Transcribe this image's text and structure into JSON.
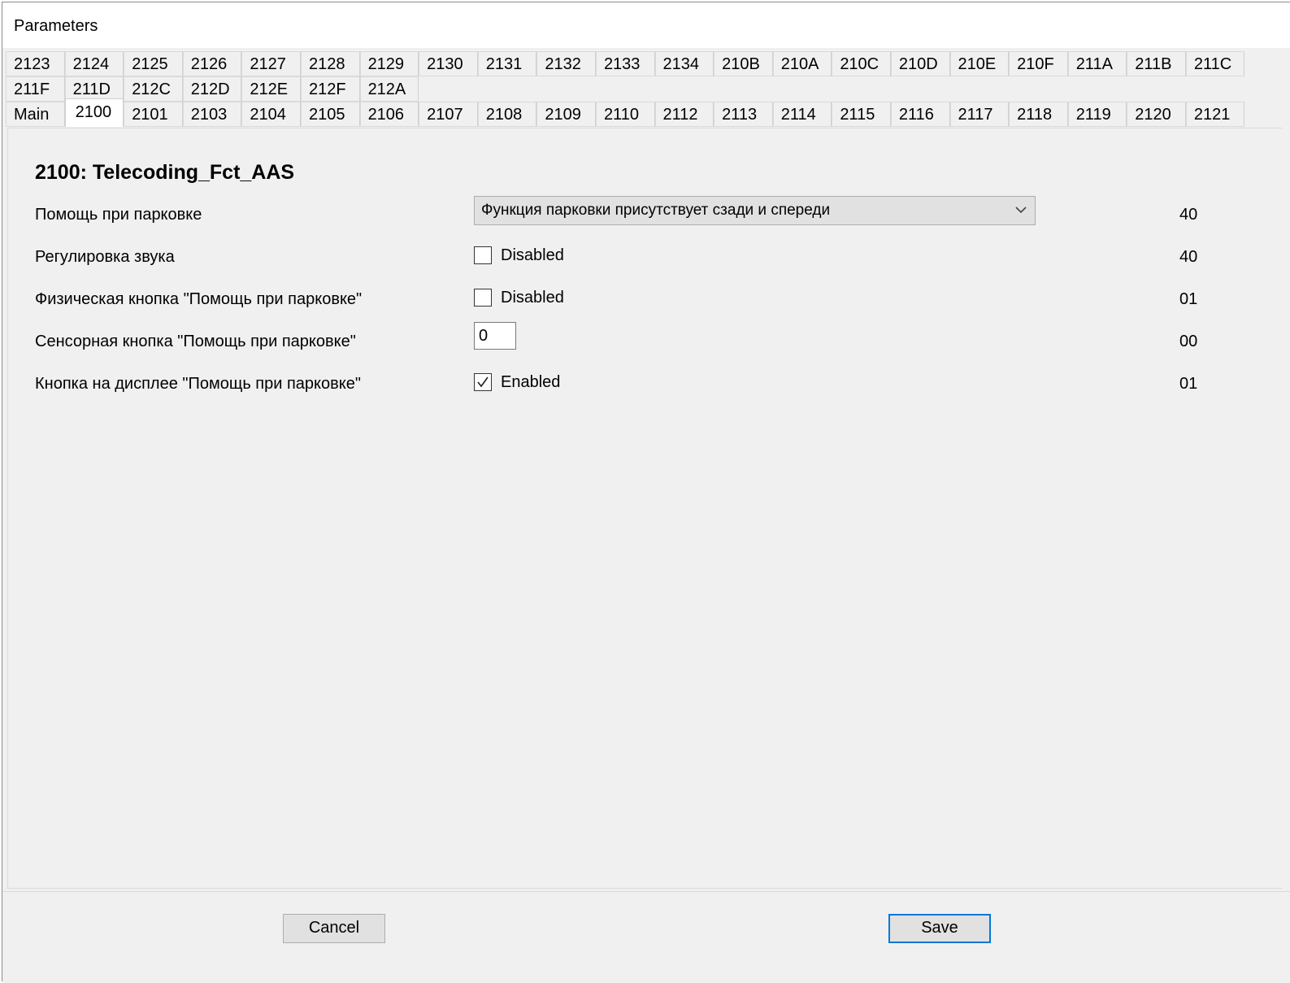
{
  "window": {
    "title": "Parameters"
  },
  "tabs": {
    "row1": [
      "2123",
      "2124",
      "2125",
      "2126",
      "2127",
      "2128",
      "2129",
      "2130",
      "2131",
      "2132",
      "2133",
      "2134",
      "210B",
      "210A",
      "210C",
      "210D",
      "210E",
      "210F",
      "211A",
      "211B",
      "211C"
    ],
    "row2": [
      "211F",
      "211D",
      "212C",
      "212D",
      "212E",
      "212F",
      "212A"
    ],
    "row3": [
      "Main",
      "2100",
      "2101",
      "2103",
      "2104",
      "2105",
      "2106",
      "2107",
      "2108",
      "2109",
      "2110",
      "2112",
      "2113",
      "2114",
      "2115",
      "2116",
      "2117",
      "2118",
      "2119",
      "2120",
      "2121"
    ],
    "active": "2100"
  },
  "panel": {
    "title": "2100: Telecoding_Fct_AAS",
    "params": [
      {
        "label": "Помощь при парковке",
        "control": "select",
        "value": "Функция парковки присутствует сзади и спереди",
        "code": "40"
      },
      {
        "label": "Регулировка звука",
        "control": "checkbox",
        "checked": false,
        "value": "Disabled",
        "code": "40"
      },
      {
        "label": "Физическая кнопка \"Помощь при парковке\"",
        "control": "checkbox",
        "checked": false,
        "value": "Disabled",
        "code": "01"
      },
      {
        "label": "Сенсорная кнопка \"Помощь при парковке\"",
        "control": "text",
        "value": "0",
        "code": "00"
      },
      {
        "label": "Кнопка на дисплее \"Помощь при парковке\"",
        "control": "checkbox",
        "checked": true,
        "value": "Enabled",
        "code": "01"
      }
    ]
  },
  "buttons": {
    "cancel": "Cancel",
    "save": "Save"
  },
  "colors": {
    "focus_border": "#0078d7",
    "window_bg": "#f0f0f0"
  }
}
